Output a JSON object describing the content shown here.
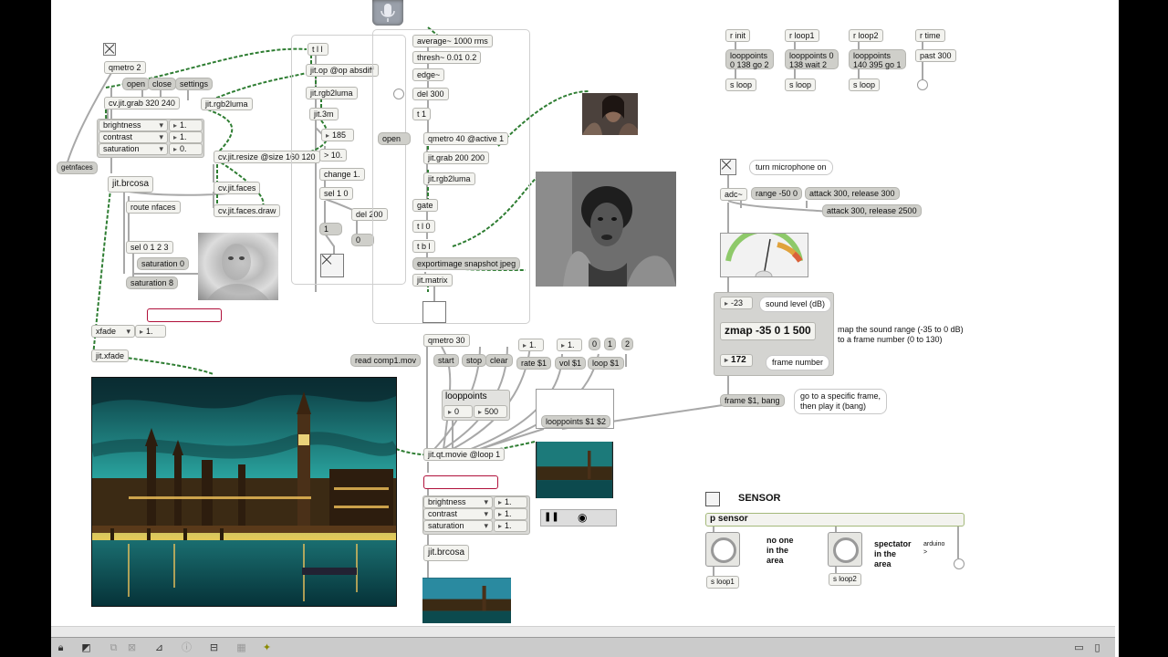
{
  "objects": {
    "qmetro2": "qmetro 2",
    "open": "open",
    "close": "close",
    "settings": "settings",
    "grab": "cv.jit.grab 320 240",
    "rgb2luma_a": "jit.rgb2luma",
    "getnfaces": "getnfaces",
    "brcosa_a": "jit.brcosa",
    "route": "route nfaces",
    "resize": "cv.jit.resize @size 160 120",
    "faces": "cv.jit.faces",
    "facesdraw": "cv.jit.faces.draw",
    "sel0123": "sel 0 1 2 3",
    "sat0": "saturation 0",
    "sat8": "saturation 8",
    "xfade_val": "1.",
    "jitxfade": "jit.xfade",
    "t_ll": "t l l",
    "jitop": "jit.op @op absdiff",
    "rgb2luma_b": "jit.rgb2luma",
    "jit3m": "jit.3m",
    "num185": "185",
    "gt10": "> 10.",
    "change1": "change 1.",
    "sel10": "sel 1 0",
    "del200": "del 200",
    "msg1": "1",
    "msg0": "0",
    "average": "average~ 1000 rms",
    "thresh": "thresh~ 0.01 0.2",
    "edge": "edge~",
    "del300": "del 300",
    "t1": "t 1",
    "open2": "open",
    "qmetro40": "qmetro 40 @active 1",
    "grab200": "jit.grab 200 200",
    "rgb2luma_c": "jit.rgb2luma",
    "gate": "gate",
    "t_l0": "t l 0",
    "t_bl": "t b l",
    "export": "exportimage snapshot jpeg",
    "jitmatrix": "jit.matrix",
    "qmetro30": "qmetro 30",
    "readmov": "read comp1.mov",
    "start": "start",
    "stop": "stop",
    "clear": "clear",
    "rate": "rate $1",
    "vol": "vol $1",
    "loop": "loop $1",
    "rate_val": "1.",
    "vol_val": "1.",
    "m0": "0",
    "m1": "1",
    "m2": "2",
    "looppoints_title": "looppoints",
    "lp0": "0",
    "lp500": "500",
    "lpmsg": "looppoints $1 $2",
    "qtmovie": "jit.qt.movie @loop 1",
    "brcosa_b": "jit.brcosa",
    "rinit": "r init",
    "rloop1": "r loop1",
    "rloop2": "r loop2",
    "rtime": "r time",
    "lp_init": "looppoints\n0 138 go 2",
    "lp_loop1": "looppoints 0\n138 wait 2",
    "lp_loop2": "looppoints\n140 395 go 1",
    "past300": "past 300",
    "sloop_a": "s loop",
    "sloop_b": "s loop",
    "sloop_c": "s loop",
    "mic_on": "turn microphone on",
    "adc": "adc~",
    "range": "range -50 0",
    "att300": "attack 300, release 300",
    "att2500": "attack 300, release 2500",
    "db_val": "-23",
    "sound_level": "sound level (dB)",
    "zmap": "zmap -35 0 1 500",
    "frame_val": "172",
    "frame_number": "frame number",
    "map_comment": "map the sound range (-35 to 0 dB)\nto a frame number (0 to 130)",
    "frame_bang": "frame $1, bang",
    "goto_comment": "go to a specific frame,\nthen play it (bang)",
    "sensor_title": "SENSOR",
    "psensor": "p sensor",
    "noone": "no one\nin the\narea",
    "spectator": "spectator\nin the\narea",
    "arduino": "arduino\n>",
    "sloop1": "s loop1",
    "sloop2": "s loop2"
  },
  "brcosa_rows": [
    {
      "label": "brightness",
      "value": "1."
    },
    {
      "label": "contrast",
      "value": "1."
    },
    {
      "label": "saturation",
      "value": "0."
    }
  ],
  "brcosa_rows2": [
    {
      "label": "brightness",
      "value": "1."
    },
    {
      "label": "contrast",
      "value": "1."
    },
    {
      "label": "saturation",
      "value": "1."
    }
  ],
  "xfade_menu": "xfade",
  "icons": [
    "lock-icon",
    "presentation-icon",
    "grid-icon",
    "inspector-icon",
    "info-icon",
    "patchcord-icon",
    "snap-icon",
    "debug-icon"
  ],
  "colors": {
    "cable_green": "#2e8b3e",
    "cable_gray": "#a8a8a8",
    "accent_red": "#b0103a"
  }
}
